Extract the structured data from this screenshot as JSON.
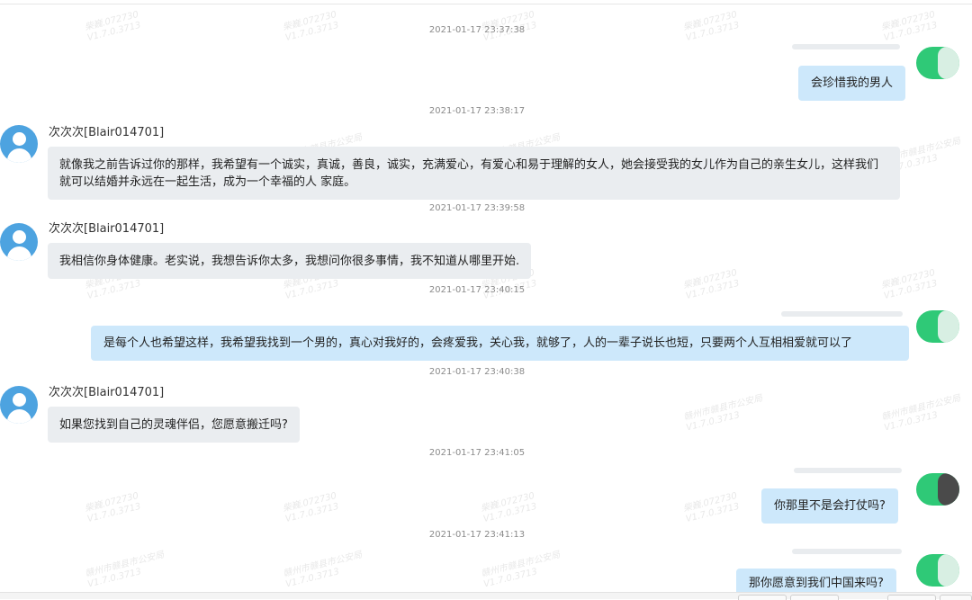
{
  "watermark": {
    "id": "柴巍.072730",
    "version": "V1.7.0.3713",
    "org": "赣州市赣县市公安局"
  },
  "messages": [
    {
      "timestamp": "2021-01-17 23:37:38",
      "direction": "out",
      "text": "会珍惜我的男人"
    },
    {
      "timestamp": "2021-01-17 23:38:17",
      "direction": "in",
      "sender": "次次次[Blair014701]",
      "text": "就像我之前告诉过你的那样，我希望有一个诚实，真诚，善良，诚实，充满爱心，有爱心和易于理解的女人，她会接受我的女儿作为自己的亲生女儿，这样我们就可以结婚并永远在一起生活，成为一个幸福的人 家庭。"
    },
    {
      "timestamp": "2021-01-17 23:39:58",
      "direction": "in",
      "sender": "次次次[Blair014701]",
      "text": "我相信你身体健康。老实说，我想告诉你太多，我想问你很多事情，我不知道从哪里开始."
    },
    {
      "timestamp": "2021-01-17 23:40:15",
      "direction": "out",
      "text": "是每个人也希望这样，我希望我找到一个男的，真心对我好的，会疼爱我，关心我，就够了，人的一辈子说长也短，只要两个人互相相爱就可以了"
    },
    {
      "timestamp": "2021-01-17 23:40:38",
      "direction": "in",
      "sender": "次次次[Blair014701]",
      "text": "如果您找到自己的灵魂伴侣，您愿意搬迁吗?"
    },
    {
      "timestamp": "2021-01-17 23:41:05",
      "direction": "out",
      "text": "你那里不是会打仗吗?"
    },
    {
      "timestamp": "2021-01-17 23:41:13",
      "direction": "out",
      "text": "那你愿意到我们中国来吗?"
    }
  ]
}
